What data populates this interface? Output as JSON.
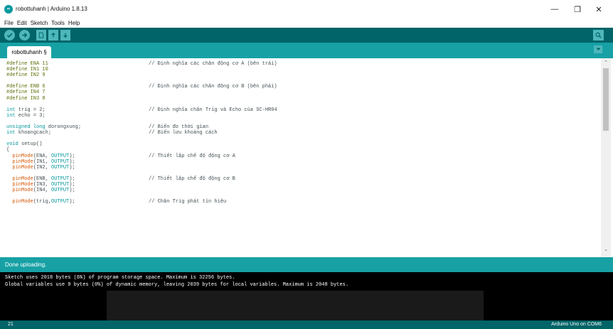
{
  "window": {
    "title": "robottuhanh | Arduino 1.8.13",
    "minimize_glyph": "—",
    "maximize_glyph": "❐",
    "close_glyph": "✕"
  },
  "menu": [
    "File",
    "Edit",
    "Sketch",
    "Tools",
    "Help"
  ],
  "toolbar": {
    "icons": [
      "verify-icon",
      "upload-icon",
      "new-icon",
      "open-icon",
      "save-icon",
      "serial-monitor-icon"
    ]
  },
  "tab": {
    "label": "robottuhanh §"
  },
  "editor": {
    "lines": [
      {
        "parts": [
          {
            "t": "#define ENA 11",
            "c": "kw-green"
          }
        ],
        "comment": "// Định nghĩa các chân động cơ A (bên trái)"
      },
      {
        "parts": [
          {
            "t": "#define IN1 10",
            "c": "kw-green"
          }
        ],
        "comment": ""
      },
      {
        "parts": [
          {
            "t": "#define IN2 9",
            "c": "kw-green"
          }
        ],
        "comment": ""
      },
      {
        "parts": [],
        "comment": ""
      },
      {
        "parts": [
          {
            "t": "#define ENB 6",
            "c": "kw-green"
          }
        ],
        "comment": "// Định nghĩa các chân động cơ B (bên phải)"
      },
      {
        "parts": [
          {
            "t": "#define IN4 7",
            "c": "kw-green"
          }
        ],
        "comment": ""
      },
      {
        "parts": [
          {
            "t": "#define IN3 8",
            "c": "kw-green"
          }
        ],
        "comment": ""
      },
      {
        "parts": [],
        "comment": ""
      },
      {
        "parts": [
          {
            "t": "int",
            "c": "kw-blue"
          },
          {
            "t": " trig = 2;",
            "c": "plain"
          }
        ],
        "comment": "// Định nghĩa chân Trig và Echo của SC-HR04"
      },
      {
        "parts": [
          {
            "t": "int",
            "c": "kw-blue"
          },
          {
            "t": " echo = 3;",
            "c": "plain"
          }
        ],
        "comment": ""
      },
      {
        "parts": [],
        "comment": ""
      },
      {
        "parts": [
          {
            "t": "unsigned long",
            "c": "kw-blue"
          },
          {
            "t": " dorongxung;",
            "c": "plain"
          }
        ],
        "comment": "// Biến đo thời gian"
      },
      {
        "parts": [
          {
            "t": "int",
            "c": "kw-blue"
          },
          {
            "t": " khoangcach;",
            "c": "plain"
          }
        ],
        "comment": "// Biến lưu khoảng cách"
      },
      {
        "parts": [],
        "comment": ""
      },
      {
        "parts": [
          {
            "t": "void",
            "c": "kw-blue"
          },
          {
            "t": " setup()",
            "c": "plain"
          }
        ],
        "comment": ""
      },
      {
        "parts": [
          {
            "t": "{",
            "c": "plain"
          }
        ],
        "comment": ""
      },
      {
        "parts": [
          {
            "t": "  pinMode",
            "c": "kw-orange"
          },
          {
            "t": "(ENA, ",
            "c": "plain"
          },
          {
            "t": "OUTPUT",
            "c": "kw-blue"
          },
          {
            "t": ");",
            "c": "plain"
          }
        ],
        "comment": "// Thiết lập chế độ động cơ A"
      },
      {
        "parts": [
          {
            "t": "  pinMode",
            "c": "kw-orange"
          },
          {
            "t": "(IN1, ",
            "c": "plain"
          },
          {
            "t": "OUTPUT",
            "c": "kw-blue"
          },
          {
            "t": ");",
            "c": "plain"
          }
        ],
        "comment": ""
      },
      {
        "parts": [
          {
            "t": "  pinMode",
            "c": "kw-orange"
          },
          {
            "t": "(IN2, ",
            "c": "plain"
          },
          {
            "t": "OUTPUT",
            "c": "kw-blue"
          },
          {
            "t": ");",
            "c": "plain"
          }
        ],
        "comment": ""
      },
      {
        "parts": [],
        "comment": ""
      },
      {
        "parts": [
          {
            "t": "  pinMode",
            "c": "kw-orange"
          },
          {
            "t": "(ENB, ",
            "c": "plain"
          },
          {
            "t": "OUTPUT",
            "c": "kw-blue"
          },
          {
            "t": ");",
            "c": "plain"
          }
        ],
        "comment": "// Thiết lập chế độ động cơ B"
      },
      {
        "parts": [
          {
            "t": "  pinMode",
            "c": "kw-orange"
          },
          {
            "t": "(IN3, ",
            "c": "plain"
          },
          {
            "t": "OUTPUT",
            "c": "kw-blue"
          },
          {
            "t": ");",
            "c": "plain"
          }
        ],
        "comment": ""
      },
      {
        "parts": [
          {
            "t": "  pinMode",
            "c": "kw-orange"
          },
          {
            "t": "(IN4, ",
            "c": "plain"
          },
          {
            "t": "OUTPUT",
            "c": "kw-blue"
          },
          {
            "t": ");",
            "c": "plain"
          }
        ],
        "comment": ""
      },
      {
        "parts": [],
        "comment": ""
      },
      {
        "parts": [
          {
            "t": "  pinMode",
            "c": "kw-orange"
          },
          {
            "t": "(trig,",
            "c": "plain"
          },
          {
            "t": "OUTPUT",
            "c": "kw-blue"
          },
          {
            "t": ");",
            "c": "plain"
          }
        ],
        "comment": "// Chân Trig phát tín hiệu"
      }
    ]
  },
  "status": {
    "message": "Done uploading."
  },
  "console": {
    "lines": [
      "Sketch uses 2018 bytes (6%) of program storage space. Maximum is 32256 bytes.",
      "Global variables use 9 bytes (0%) of dynamic memory, leaving 2039 bytes for local variables. Maximum is 2048 bytes."
    ]
  },
  "footer": {
    "line_number": "21",
    "board": "Arduino Uno on COM6"
  },
  "colors": {
    "toolbar": "#006468",
    "tabbar": "#17a1a5",
    "button": "#4db7bb",
    "keyword_green": "#5e6d03",
    "keyword_blue": "#00979c",
    "function_orange": "#d35400"
  }
}
